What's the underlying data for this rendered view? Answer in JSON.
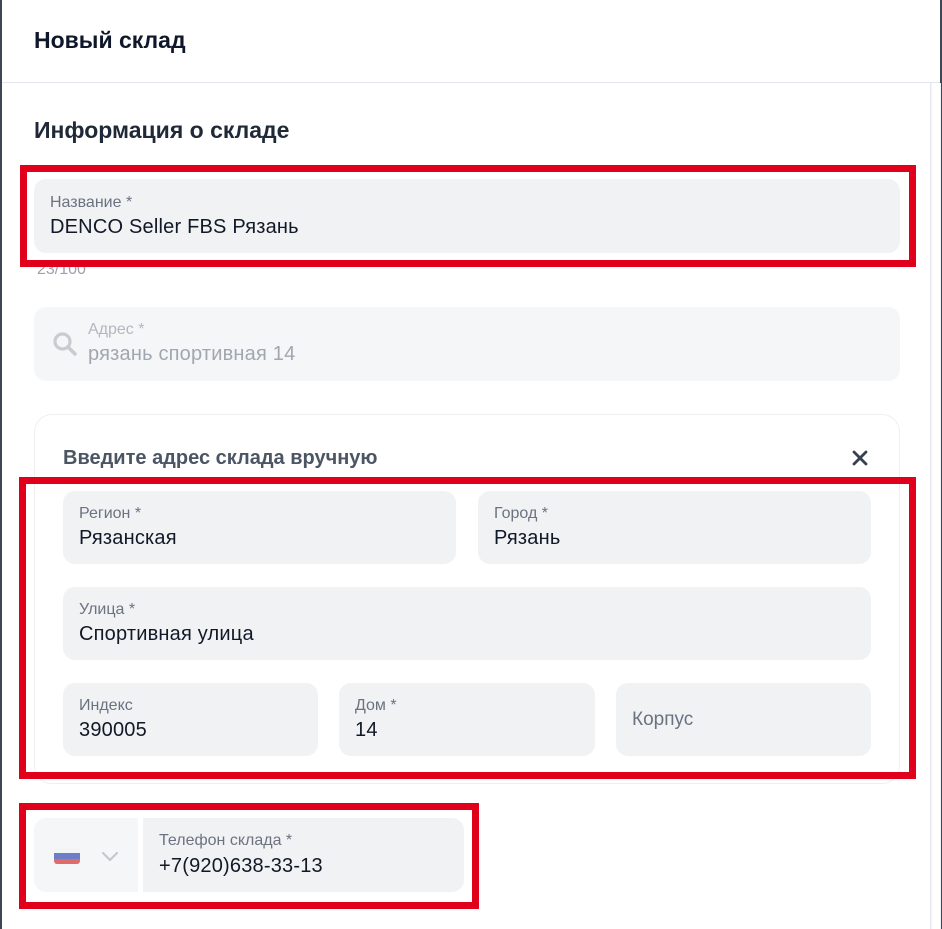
{
  "header": {
    "title": "Новый склад"
  },
  "section": {
    "title": "Информация о складе"
  },
  "name_field": {
    "label": "Название *",
    "value": "DENCO Seller FBS Рязань",
    "counter": "23/100"
  },
  "address_field": {
    "label": "Адрес *",
    "value": "рязань спортивная 14",
    "icon": "search-icon"
  },
  "manual": {
    "title": "Введите адрес склада вручную",
    "close_icon": "close-icon",
    "region": {
      "label": "Регион *",
      "value": "Рязанская"
    },
    "city": {
      "label": "Город *",
      "value": "Рязань"
    },
    "street": {
      "label": "Улица *",
      "value": "Спортивная улица"
    },
    "index": {
      "label": "Индекс",
      "value": "390005"
    },
    "house": {
      "label": "Дом *",
      "value": "14"
    },
    "building": {
      "placeholder": "Корпус"
    }
  },
  "phone": {
    "country_flag": "russia-flag-icon",
    "label": "Телефон склада *",
    "value": "+7(920)638-33-13"
  },
  "colors": {
    "highlight": "#e0001b",
    "field_bg": "#f1f2f4"
  }
}
